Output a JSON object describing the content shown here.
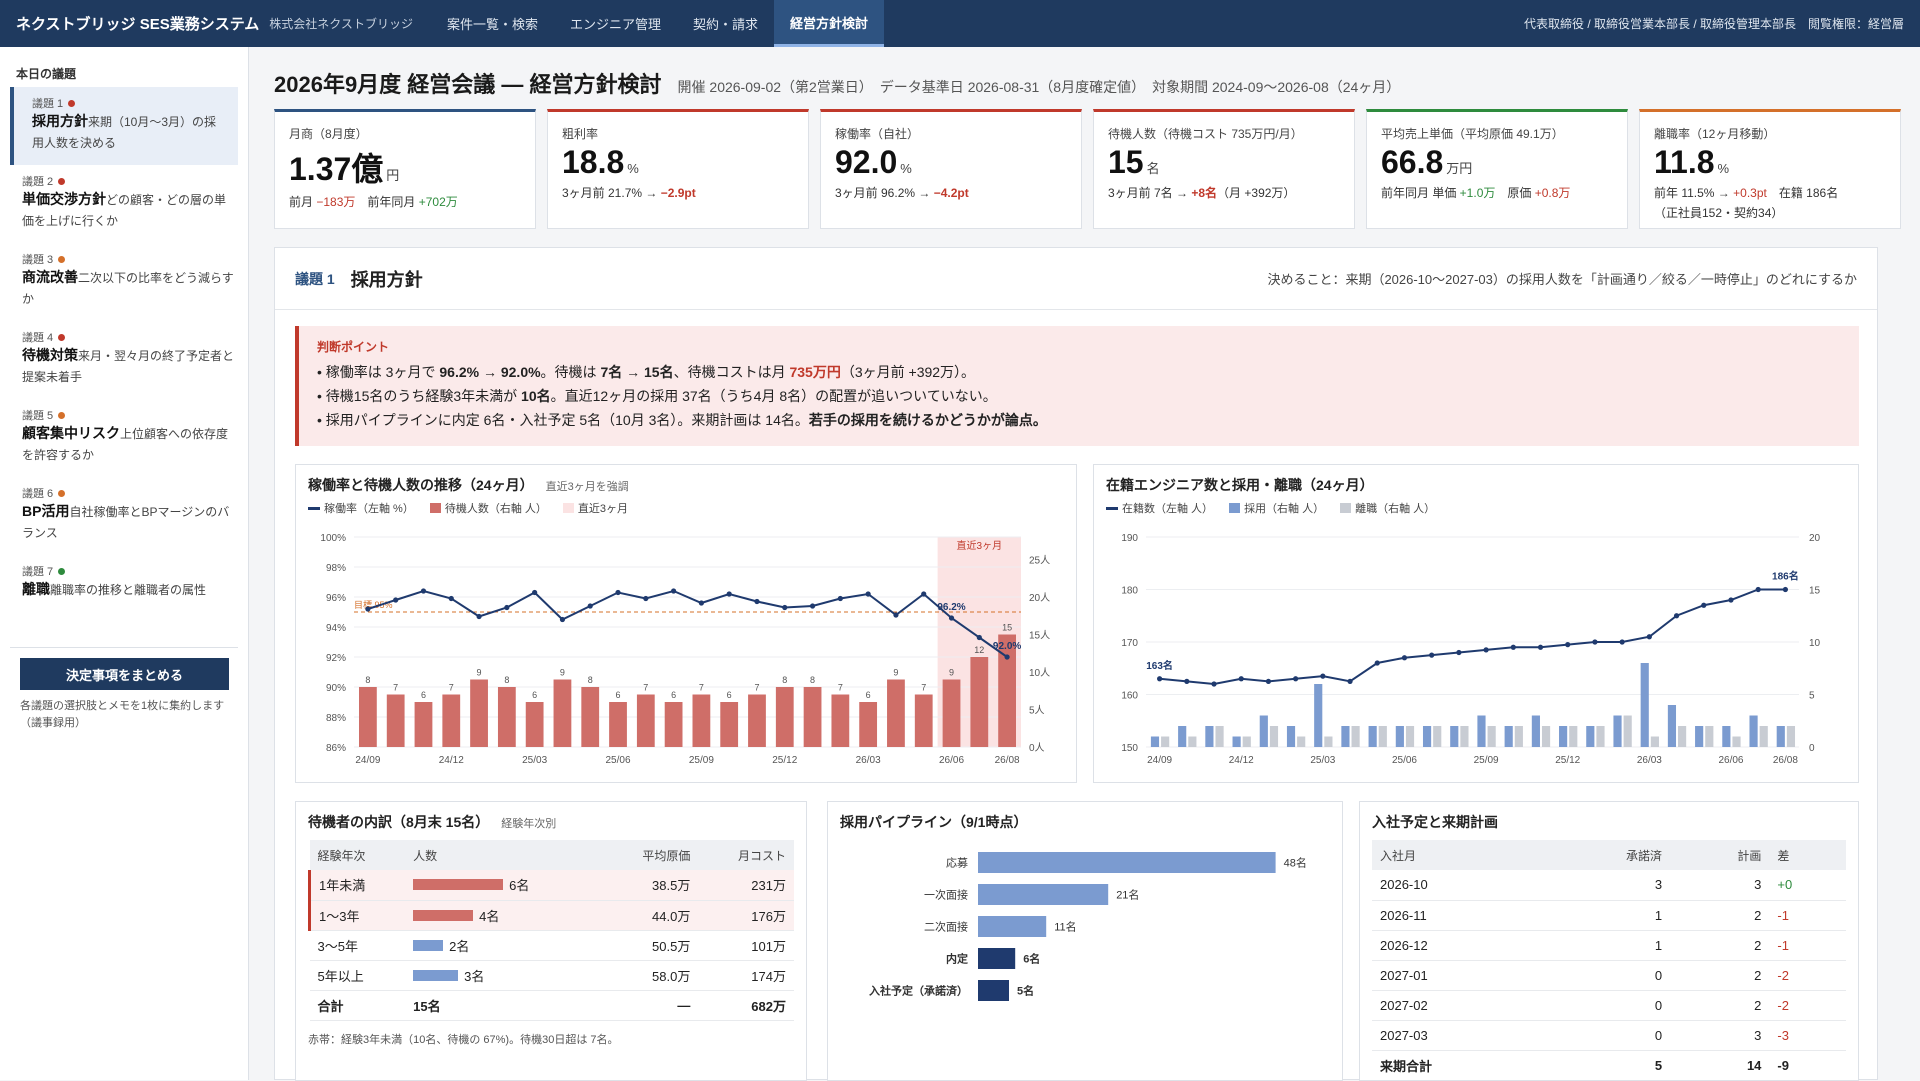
{
  "header": {
    "brand": "ネクストブリッジ SES業務システム",
    "company": "株式会社ネクストブリッジ",
    "nav": [
      "案件一覧・検索",
      "エンジニア管理",
      "契約・請求",
      "経営方針検討"
    ],
    "user": "代表取締役 / 取締役営業本部長 / 取締役管理本部長　閲覧権限：経営層"
  },
  "sidebar": {
    "heading": "本日の議題",
    "items": [
      {
        "num": "議題 1",
        "title": "採用方針",
        "desc": "来期（10月〜3月）の採用人数を決める",
        "status_color": "#c0392b"
      },
      {
        "num": "議題 2",
        "title": "単価交渉方針",
        "desc": "どの顧客・どの層の単価を上げに行くか",
        "status_color": "#c0392b"
      },
      {
        "num": "議題 3",
        "title": "商流改善",
        "desc": "二次以下の比率をどう減らすか",
        "status_color": "#d4702a"
      },
      {
        "num": "議題 4",
        "title": "待機対策",
        "desc": "来月・翌々月の終了予定者と提案未着手",
        "status_color": "#c0392b"
      },
      {
        "num": "議題 5",
        "title": "顧客集中リスク",
        "desc": "上位顧客への依存度を許容するか",
        "status_color": "#d4702a"
      },
      {
        "num": "議題 6",
        "title": "BP活用",
        "desc": "自社稼働率とBPマージンのバランス",
        "status_color": "#d4702a"
      },
      {
        "num": "議題 7",
        "title": "離職",
        "desc": "離職率の推移と離職者の属性",
        "status_color": "#2e8b3d"
      }
    ],
    "button": "決定事項をまとめる",
    "note": "各議題の選択肢とメモを1枚に集約します（議事録用）"
  },
  "page": {
    "title": "2026年9月度 経営会議 — 経営方針検討",
    "meta": "開催 2026-09-02（第2営業日）　データ基準日 2026-08-31（8月度確定値）　対象期間 2024-09〜2026-08（24ヶ月）"
  },
  "kpis": [
    {
      "label": "月商（8月度）",
      "value": "1.37億",
      "unit": "円",
      "accent": "#2e5381",
      "sub": [
        {
          "t": "前月 "
        },
        {
          "t": "−183万",
          "c": "red"
        },
        {
          "t": "　前年同月 "
        },
        {
          "t": "+702万",
          "c": "green"
        }
      ]
    },
    {
      "label": "粗利率",
      "value": "18.8",
      "unit": "%",
      "accent": "#c0392b",
      "sub": [
        {
          "t": "3ヶ月前 21.7% → "
        },
        {
          "t": "−2.9pt",
          "c": "red b"
        }
      ]
    },
    {
      "label": "稼働率（自社）",
      "value": "92.0",
      "unit": "%",
      "accent": "#c0392b",
      "sub": [
        {
          "t": "3ヶ月前 96.2% → "
        },
        {
          "t": "−4.2pt",
          "c": "red b"
        }
      ]
    },
    {
      "label": "待機人数（待機コスト 735万円/月）",
      "value": "15",
      "unit": "名",
      "accent": "#c0392b",
      "sub": [
        {
          "t": "3ヶ月前 7名 → "
        },
        {
          "t": "+8名",
          "c": "red b"
        },
        {
          "t": "（月 +392万）"
        }
      ]
    },
    {
      "label": "平均売上単価（平均原価 49.1万）",
      "value": "66.8",
      "unit": "万円",
      "accent": "#2e8b3d",
      "sub": [
        {
          "t": "前年同月 単価 "
        },
        {
          "t": "+1.0万",
          "c": "green"
        },
        {
          "t": "　原価 "
        },
        {
          "t": "+0.8万",
          "c": "red"
        }
      ]
    },
    {
      "label": "離職率（12ヶ月移動）",
      "value": "11.8",
      "unit": "%",
      "accent": "#d4702a",
      "sub": [
        {
          "t": "前年 11.5% → "
        },
        {
          "t": "+0.3pt",
          "c": "red"
        },
        {
          "t": "　在籍 186名"
        }
      ],
      "sub2": "（正社員152・契約34）"
    }
  ],
  "topic": {
    "num": "議題 1",
    "title": "採用方針",
    "decide": "決めること：来期（2026-10〜2027-03）の採用人数を「計画通り／絞る／一時停止」のどれにするか",
    "judge_head": "判断ポイント",
    "lines": [
      [
        {
          "t": "稼働率は 3ヶ月で "
        },
        {
          "t": "96.2% → 92.0%",
          "c": "b"
        },
        {
          "t": "。待機は "
        },
        {
          "t": "7名",
          "c": "b"
        },
        {
          "t": " → "
        },
        {
          "t": "15名",
          "c": "b"
        },
        {
          "t": "、待機コストは月 "
        },
        {
          "t": "735万円",
          "c": "red b"
        },
        {
          "t": "（3ヶ月前 +392万）。"
        }
      ],
      [
        {
          "t": "待機15名のうち経験3年未満が "
        },
        {
          "t": "10名",
          "c": "b"
        },
        {
          "t": "。直近12ヶ月の採用 37名（うち4月 8名）の配置が追いついていない。"
        }
      ],
      [
        {
          "t": "採用パイプラインに内定 6名・入社予定 5名（10月 3名）。来期計画は 14名。"
        },
        {
          "t": "若手の採用を続けるかどうかが論点。",
          "c": "b"
        }
      ]
    ]
  },
  "chart_data": [
    {
      "type": "line",
      "title": "稼働率と待機人数の推移（24ヶ月）",
      "subtitle": "直近3ヶ月を強調",
      "legend": [
        "稼働率（左軸 %）",
        "待機人数（右軸 人）",
        "直近3ヶ月"
      ],
      "x": [
        "24/09",
        "24/10",
        "24/11",
        "24/12",
        "25/01",
        "25/02",
        "25/03",
        "25/04",
        "25/05",
        "25/06",
        "25/07",
        "25/08",
        "25/09",
        "25/10",
        "25/11",
        "25/12",
        "26/01",
        "26/02",
        "26/03",
        "26/04",
        "26/05",
        "26/06",
        "26/07",
        "26/08"
      ],
      "xticks": [
        "24/09",
        "24/12",
        "25/03",
        "25/06",
        "25/09",
        "25/12",
        "26/03",
        "26/06",
        "26/08"
      ],
      "series": [
        {
          "name": "稼働率（左軸 %）",
          "axis": "left",
          "color": "#1f3a6e",
          "values": [
            95.2,
            95.8,
            96.4,
            95.9,
            94.7,
            95.3,
            96.3,
            94.5,
            95.4,
            96.3,
            95.9,
            96.4,
            95.6,
            96.2,
            95.7,
            95.3,
            95.4,
            95.9,
            96.2,
            94.8,
            96.2,
            94.6,
            93.3,
            92.0
          ]
        },
        {
          "name": "待機人数（右軸 人）",
          "axis": "right",
          "color": "#cf6e68",
          "values": [
            8,
            7,
            6,
            7,
            9,
            8,
            6,
            9,
            8,
            6,
            7,
            6,
            7,
            6,
            7,
            8,
            8,
            7,
            6,
            9,
            7,
            9,
            12,
            15
          ]
        }
      ],
      "ylim_left": [
        86,
        100
      ],
      "yticks_left": [
        "86%",
        "88%",
        "90%",
        "92%",
        "94%",
        "96%",
        "98%",
        "100%"
      ],
      "ylim_right": [
        0,
        28
      ],
      "yticks_right": [
        "0人",
        "5人",
        "10人",
        "15人",
        "20人",
        "25人"
      ],
      "target": {
        "value": 95,
        "label": "目標 95%"
      },
      "highlight": {
        "from": "26/06",
        "to": "26/08",
        "label": "直近3ヶ月"
      },
      "labels": [
        "96.2%",
        "92.0%"
      ]
    },
    {
      "type": "bar",
      "title": "在籍エンジニア数と採用・離職（24ヶ月）",
      "legend": [
        "在籍数（左軸 人）",
        "採用（右軸 人）",
        "離職（右軸 人）"
      ],
      "x": [
        "24/09",
        "24/10",
        "24/11",
        "24/12",
        "25/01",
        "25/02",
        "25/03",
        "25/04",
        "25/05",
        "25/06",
        "25/07",
        "25/08",
        "25/09",
        "25/10",
        "25/11",
        "25/12",
        "26/01",
        "26/02",
        "26/03",
        "26/04",
        "26/05",
        "26/06",
        "26/07",
        "26/08"
      ],
      "xticks": [
        "24/09",
        "24/12",
        "25/03",
        "25/06",
        "25/09",
        "25/12",
        "26/03",
        "26/06",
        "26/08"
      ],
      "series": [
        {
          "name": "在籍数（左軸 人）",
          "axis": "left",
          "color": "#1f3a6e",
          "values": [
            163,
            162.5,
            162,
            163,
            162.5,
            163,
            163.5,
            162.5,
            166,
            167,
            167.5,
            168,
            168.5,
            169,
            169,
            169.5,
            170,
            170,
            171,
            175,
            177,
            178,
            180,
            180
          ]
        },
        {
          "name": "採用（右軸 人）",
          "axis": "right",
          "color": "#7b9bd0",
          "values": [
            1,
            2,
            2,
            1,
            3,
            2,
            6,
            2,
            2,
            2,
            2,
            2,
            3,
            2,
            3,
            2,
            2,
            3,
            8,
            4,
            2,
            2,
            3,
            2
          ]
        },
        {
          "name": "離職（右軸 人）",
          "axis": "right",
          "color": "#c8ccd3",
          "values": [
            1,
            1,
            2,
            1,
            2,
            1,
            1,
            2,
            2,
            2,
            2,
            2,
            2,
            2,
            2,
            2,
            2,
            3,
            1,
            2,
            2,
            1,
            2,
            2
          ]
        }
      ],
      "ylim_left": [
        150,
        190
      ],
      "yticks_left": [
        "150",
        "160",
        "170",
        "180",
        "190"
      ],
      "ylim_right": [
        0,
        20
      ],
      "yticks_right": [
        "0",
        "5",
        "10",
        "15",
        "20"
      ],
      "labels": [
        "163名",
        "186名"
      ]
    },
    {
      "type": "bar",
      "title": "採用パイプライン（9/1時点）",
      "categories": [
        "応募",
        "一次面接",
        "二次面接",
        "内定",
        "入社予定（承諾済）"
      ],
      "values": [
        48,
        21,
        11,
        6,
        5
      ],
      "value_labels": [
        "48名",
        "21名",
        "11名",
        "6名",
        "5名"
      ],
      "colors": [
        "#7b9bd0",
        "#7b9bd0",
        "#7b9bd0",
        "#1f3a6e",
        "#1f3a6e"
      ],
      "xlim": [
        0,
        50
      ]
    }
  ],
  "waiting": {
    "title": "待機者の内訳（8月末 15名）",
    "sub": "経験年次別",
    "headers": [
      "経験年次",
      "人数",
      "平均原価",
      "月コスト"
    ],
    "rows": [
      {
        "label": "1年未満",
        "count": "6名",
        "n": 6,
        "cost": "38.5万",
        "month": "231万",
        "hl": true,
        "color": "#cf6e68"
      },
      {
        "label": "1〜3年",
        "count": "4名",
        "n": 4,
        "cost": "44.0万",
        "month": "176万",
        "hl": true,
        "color": "#cf6e68"
      },
      {
        "label": "3〜5年",
        "count": "2名",
        "n": 2,
        "cost": "50.5万",
        "month": "101万",
        "hl": false,
        "color": "#7b9bd0"
      },
      {
        "label": "5年以上",
        "count": "3名",
        "n": 3,
        "cost": "58.0万",
        "month": "174万",
        "hl": false,
        "color": "#7b9bd0"
      }
    ],
    "total": {
      "label": "合計",
      "count": "15名",
      "cost": "—",
      "month": "682万"
    },
    "note": "赤帯：経験3年未満（10名、待機の 67%)。待機30日超は 7名。"
  },
  "plan": {
    "title": "入社予定と来期計画",
    "headers": [
      "入社月",
      "承諾済",
      "計画",
      "差"
    ],
    "rows": [
      {
        "m": "2026-10",
        "a": "3",
        "p": "3",
        "d": "+0",
        "dc": "green"
      },
      {
        "m": "2026-11",
        "a": "1",
        "p": "2",
        "d": "-1",
        "dc": "red"
      },
      {
        "m": "2026-12",
        "a": "1",
        "p": "2",
        "d": "-1",
        "dc": "red"
      },
      {
        "m": "2027-01",
        "a": "0",
        "p": "2",
        "d": "-2",
        "dc": "red"
      },
      {
        "m": "2027-02",
        "a": "0",
        "p": "2",
        "d": "-2",
        "dc": "red"
      },
      {
        "m": "2027-03",
        "a": "0",
        "p": "3",
        "d": "-3",
        "dc": "red"
      }
    ],
    "total": {
      "m": "来期合計",
      "a": "5",
      "p": "14",
      "d": "-9"
    }
  },
  "colors": {
    "navy": "#1f3a5f",
    "accent_red": "#c0392b",
    "accent_green": "#2e8b3d",
    "accent_orange": "#d4702a",
    "highlight_bg": "#fbeaea"
  }
}
